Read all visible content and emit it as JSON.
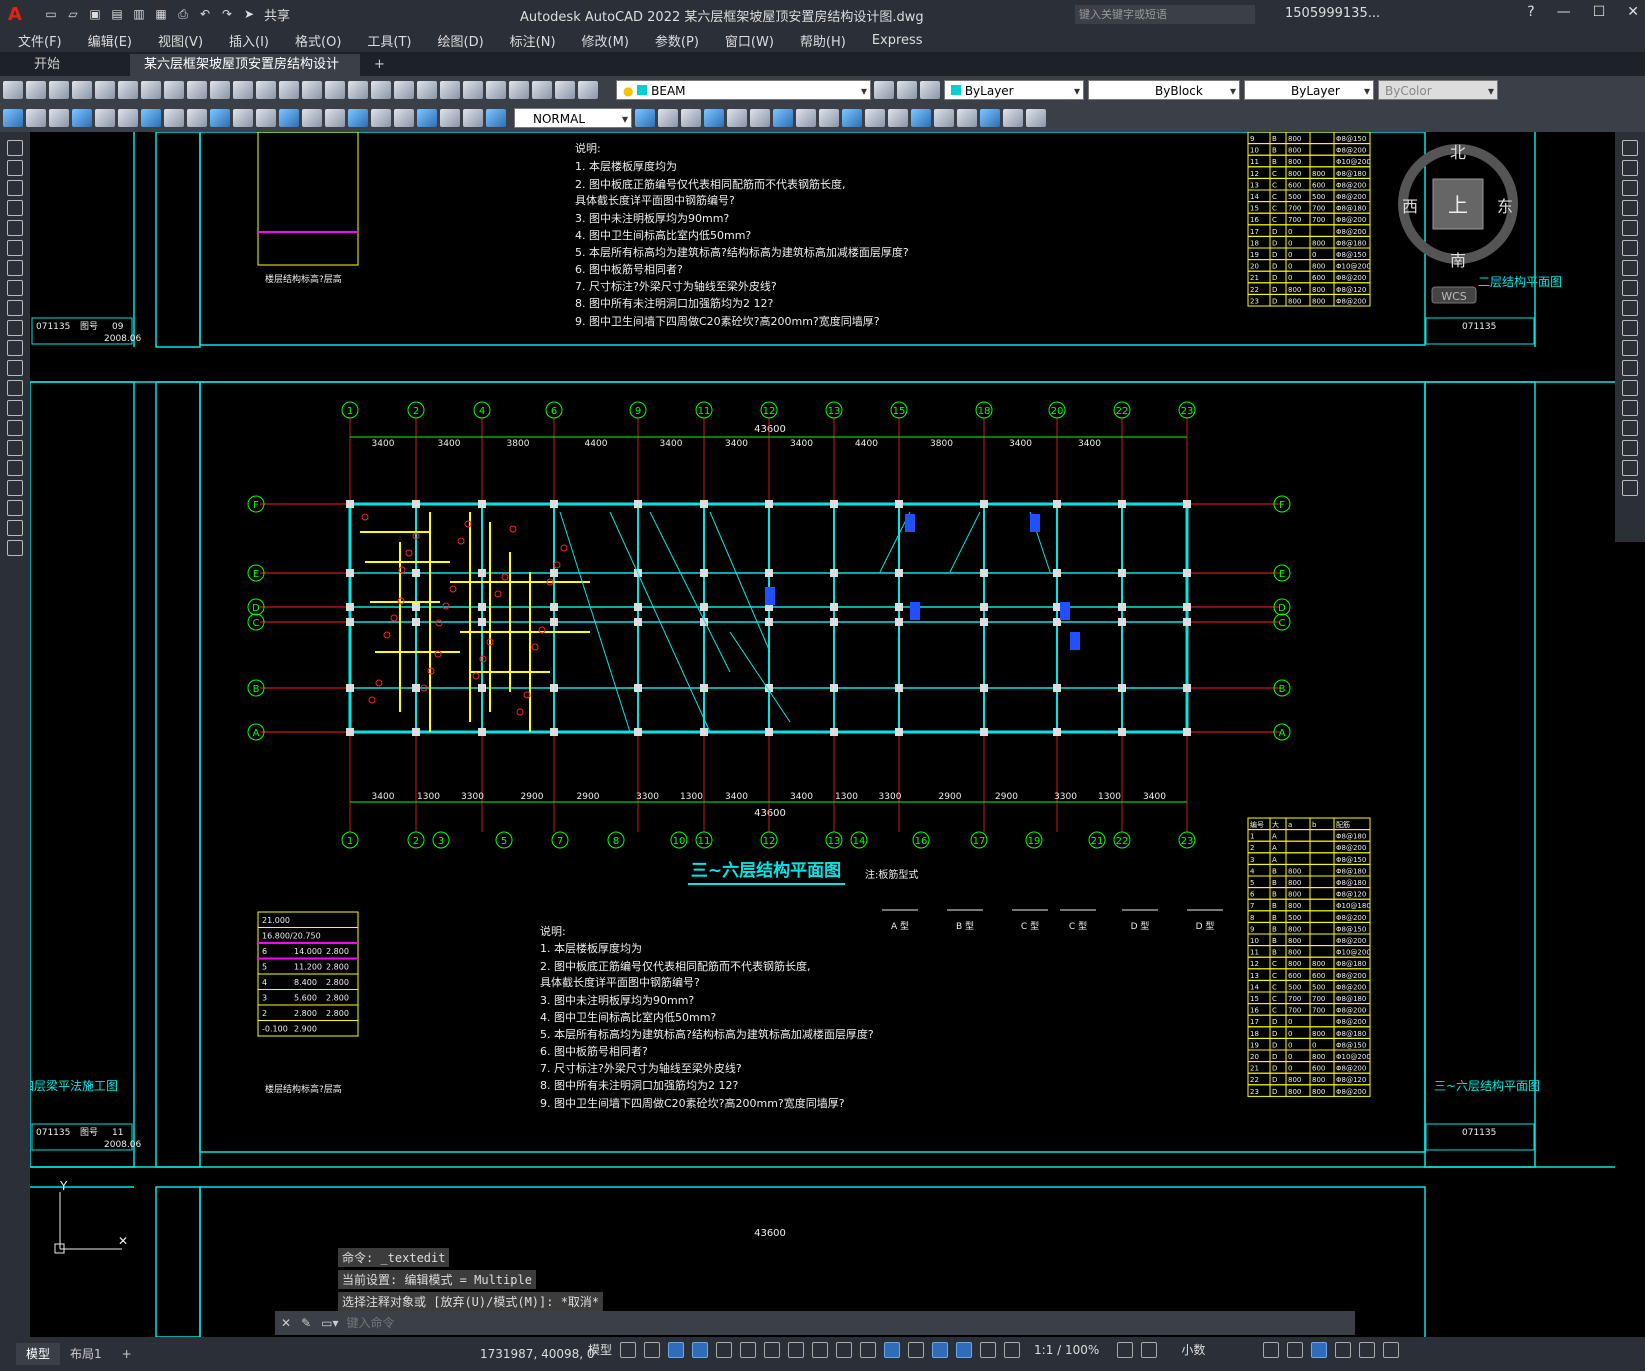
{
  "app": {
    "title": "Autodesk AutoCAD 2022    某六层框架坡屋顶安置房结构设计图.dwg",
    "share": "共享",
    "search_placeholder": "键入关键字或短语",
    "user": "1505999135...",
    "logo": "A"
  },
  "menu": [
    "文件(F)",
    "编辑(E)",
    "视图(V)",
    "插入(I)",
    "格式(O)",
    "工具(T)",
    "绘图(D)",
    "标注(N)",
    "修改(M)",
    "参数(P)",
    "窗口(W)",
    "帮助(H)",
    "Express"
  ],
  "tabs": {
    "start": "开始",
    "doc": "某六层框架坡屋顶安置房结构设计图*",
    "add": "+"
  },
  "toolbar": {
    "layer": "BEAM",
    "color": "ByLayer",
    "linetype": "ByBlock",
    "lineweight": "ByLayer",
    "plotstyle": "ByColor",
    "dimstyle": "NORMAL"
  },
  "viewcube": {
    "north": "北",
    "south": "南",
    "east": "东",
    "west": "西",
    "top": "上",
    "wcs": "WCS"
  },
  "drawing": {
    "plan_title": "三~六层结构平面图",
    "second_floor_title": "二层结构平面图",
    "right_title_2": "三~六层结构平面图",
    "left_title": "四层梁平法施工图",
    "note_head": "说明:",
    "notes": [
      "1.  本层楼板厚度均为",
      "2.  图中板底正筋编号仅代表相同配筋而不代表钢筋长度,",
      "     具体截长度详平面图中钢筋编号?",
      "3.  图中未注明板厚均为90mm?",
      "4.  图中卫生间标高比室内低50mm?",
      "5.  本层所有标高均为建筑标高?结构标高为建筑标高加减楼面层厚度?",
      "6.  图中板筋号相同者?",
      "7.  尺寸标注?外梁尺寸为轴线至梁外皮线?",
      "8.  图中所有未注明洞口加强筋均为2  12?",
      "9.  图中卫生间墙下四周做C20素砼坎?高200mm?宽度同墙厚?"
    ],
    "dim_total": "43600",
    "axis_top": [
      "1",
      "2",
      "4",
      "6",
      "9",
      "11",
      "12",
      "13",
      "15",
      "18",
      "20",
      "22",
      "23"
    ],
    "axis_bottom": [
      "1",
      "2",
      "3",
      "5",
      "7",
      "8",
      "10",
      "11",
      "12",
      "13",
      "14",
      "16",
      "17",
      "19",
      "21",
      "22",
      "23"
    ],
    "axis_side": [
      "F",
      "E",
      "D",
      "C",
      "B",
      "A"
    ],
    "dims_top": [
      "3400",
      "3400",
      "3800",
      "4400",
      "3400",
      "3400",
      "3400",
      "4400",
      "3800",
      "3400",
      "3400"
    ],
    "dims_bottom": [
      "3400",
      "1300",
      "3300",
      "2900",
      "2900",
      "3300",
      "1300",
      "3400",
      "3400",
      "1300",
      "3300",
      "2900",
      "2900",
      "3300",
      "1300",
      "3400"
    ],
    "floor_table": [
      [
        "21.000",
        ""
      ],
      [
        "16.800/20.750",
        ""
      ],
      [
        "6",
        "14.000",
        "2.800"
      ],
      [
        "5",
        "11.200",
        "2.800"
      ],
      [
        "4",
        "8.400",
        "2.800"
      ],
      [
        "3",
        "5.600",
        "2.800"
      ],
      [
        "2",
        "2.800",
        "2.800"
      ],
      [
        "-0.100",
        "2.900"
      ]
    ],
    "floor_table_caption": "楼层结构标高?层高",
    "slab_table_head": [
      "编号",
      "大",
      "a",
      "b",
      "配筋"
    ],
    "slab_table_rows": [
      [
        "1",
        "A",
        "",
        "",
        "Φ8@180"
      ],
      [
        "2",
        "A",
        "",
        "",
        "Φ8@200"
      ],
      [
        "3",
        "A",
        "",
        "",
        "Φ8@150"
      ],
      [
        "4",
        "B",
        "800",
        "",
        "Φ8@180"
      ],
      [
        "5",
        "B",
        "800",
        "",
        "Φ8@180"
      ],
      [
        "6",
        "B",
        "800",
        "",
        "Φ8@120"
      ],
      [
        "7",
        "B",
        "800",
        "",
        "Φ10@180"
      ],
      [
        "8",
        "B",
        "500",
        "",
        "Φ8@200"
      ],
      [
        "9",
        "B",
        "800",
        "",
        "Φ8@150"
      ],
      [
        "10",
        "B",
        "800",
        "",
        "Φ8@200"
      ],
      [
        "11",
        "B",
        "800",
        "",
        "Φ10@200"
      ],
      [
        "12",
        "C",
        "800",
        "800",
        "Φ8@180"
      ],
      [
        "13",
        "C",
        "600",
        "600",
        "Φ8@200"
      ],
      [
        "14",
        "C",
        "500",
        "500",
        "Φ8@200"
      ],
      [
        "15",
        "C",
        "700",
        "700",
        "Φ8@180"
      ],
      [
        "16",
        "C",
        "700",
        "700",
        "Φ8@200"
      ],
      [
        "17",
        "D",
        "0",
        "",
        "Φ8@200"
      ],
      [
        "18",
        "D",
        "0",
        "800",
        "Φ8@180"
      ],
      [
        "19",
        "D",
        "0",
        "0",
        "Φ8@150"
      ],
      [
        "20",
        "D",
        "0",
        "800",
        "Φ10@200"
      ],
      [
        "21",
        "D",
        "0",
        "600",
        "Φ8@200"
      ],
      [
        "22",
        "D",
        "800",
        "800",
        "Φ8@120"
      ],
      [
        "23",
        "D",
        "800",
        "800",
        "Φ8@200"
      ]
    ],
    "titleblock": {
      "code": "071135",
      "label": "图号",
      "sheet1": "09",
      "sheet2": "11",
      "date": "2008.06"
    },
    "legend_types": [
      "A 型",
      "B 型",
      "C 型",
      "C 型",
      "D 型",
      "D 型"
    ],
    "legend_note": "注:板筋型式"
  },
  "command": {
    "lines": [
      "命令: _textedit",
      "当前设置: 编辑模式 = Multiple",
      "选择注释对象或 [放弃(U)/模式(M)]: *取消*"
    ],
    "placeholder": "键入命令"
  },
  "status": {
    "model_tab": "模型",
    "layout_tab": "布局1",
    "coords": "1731987, 40098, 0",
    "space": "模型",
    "scale": "1:1 / 100%",
    "units": "小数"
  }
}
